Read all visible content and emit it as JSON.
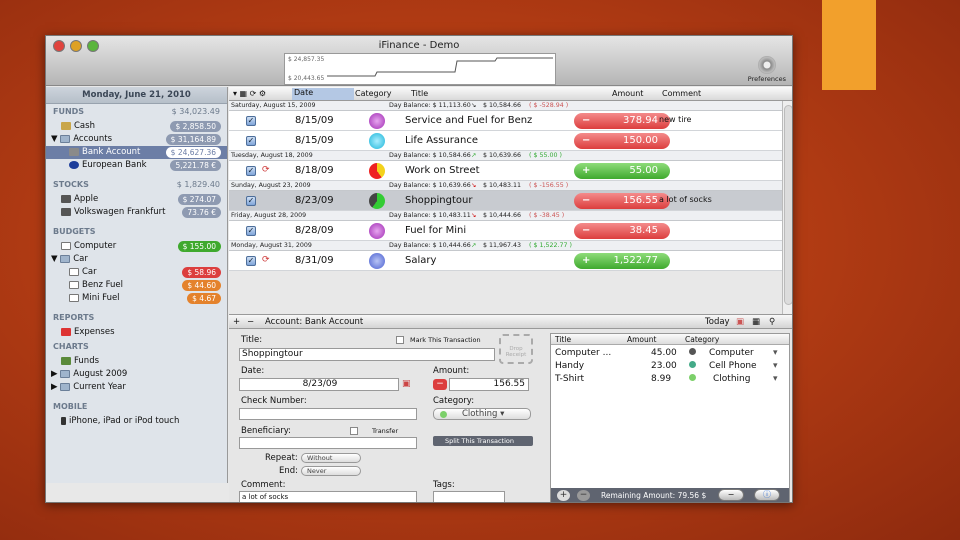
{
  "window": {
    "title": "iFinance - Demo"
  },
  "chart_header": {
    "label_top": "$ 24,857.35",
    "label_bottom": "$ 20,443.65"
  },
  "toolbar": {
    "preferences": "Preferences"
  },
  "sidebar": {
    "date": "Monday, June 21, 2010",
    "funds": {
      "label": "FUNDS",
      "amount": "$ 34,023.49",
      "items": [
        {
          "label": "Cash",
          "badge": "$ 2,858.50"
        },
        {
          "label": "Accounts",
          "badge": "$ 31,164.89"
        },
        {
          "label": "Bank Account",
          "badge": "$ 24,627.36"
        },
        {
          "label": "European Bank",
          "badge": "5,221.78 €"
        }
      ]
    },
    "stocks": {
      "label": "STOCKS",
      "amount": "$ 1,829.40",
      "items": [
        {
          "label": "Apple",
          "badge": "$ 274.07"
        },
        {
          "label": "Volkswagen Frankfurt",
          "badge": "73.76 €"
        }
      ]
    },
    "budgets": {
      "label": "BUDGETS",
      "items": [
        {
          "label": "Computer",
          "badge": "$ 155.00"
        },
        {
          "label": "Car"
        },
        {
          "label": "Car",
          "badge": "$ 58.96"
        },
        {
          "label": "Benz Fuel",
          "badge": "$ 44.60"
        },
        {
          "label": "Mini Fuel",
          "badge": "$ 4.67"
        }
      ]
    },
    "reports": {
      "label": "REPORTS",
      "items": [
        {
          "label": "Expenses"
        }
      ]
    },
    "charts": {
      "label": "CHARTS",
      "items": [
        {
          "label": "Funds"
        },
        {
          "label": "August 2009"
        },
        {
          "label": "Current Year"
        }
      ]
    },
    "mobile": {
      "label": "MOBILE",
      "items": [
        {
          "label": "iPhone, iPad or iPod touch"
        }
      ]
    }
  },
  "table": {
    "columns": [
      "Date",
      "Category",
      "Title",
      "Amount",
      "Comment"
    ],
    "days": [
      {
        "day": "Saturday, August 15, 2009",
        "balance": "Day Balance: $ 11,113.60",
        "after": "$ 10,584.66",
        "delta": "( $ -528.94 )"
      },
      {
        "day": "Tuesday, August 18, 2009",
        "balance": "Day Balance: $ 10,584.66",
        "after": "$ 10,639.66",
        "delta": "( $ 55.00 )"
      },
      {
        "day": "Sunday, August 23, 2009",
        "balance": "Day Balance: $ 10,639.66",
        "after": "$ 10,483.11",
        "delta": "( $ -156.55 )"
      },
      {
        "day": "Friday, August 28, 2009",
        "balance": "Day Balance: $ 10,483.11",
        "after": "$ 10,444.66",
        "delta": "( $ -38.45 )"
      },
      {
        "day": "Monday, August 31, 2009",
        "balance": "Day Balance: $ 10,444.66",
        "after": "$ 11,967.43",
        "delta": "( $ 1,522.77 )"
      }
    ],
    "rows": [
      {
        "date": "8/15/09",
        "title": "Service and Fuel for Benz",
        "amount": "378.94",
        "sign": "−",
        "comment": "new tire"
      },
      {
        "date": "8/15/09",
        "title": "Life Assurance",
        "amount": "150.00",
        "sign": "−",
        "comment": ""
      },
      {
        "date": "8/18/09",
        "title": "Work on Street",
        "amount": "55.00",
        "sign": "+",
        "comment": ""
      },
      {
        "date": "8/23/09",
        "title": "Shoppingtour",
        "amount": "156.55",
        "sign": "−",
        "comment": "a lot of socks"
      },
      {
        "date": "8/28/09",
        "title": "Fuel for Mini",
        "amount": "38.45",
        "sign": "−",
        "comment": ""
      },
      {
        "date": "8/31/09",
        "title": "Salary",
        "amount": "1,522.77",
        "sign": "+",
        "comment": ""
      }
    ],
    "footer": {
      "account": "Account: Bank Account",
      "today": "Today"
    }
  },
  "form": {
    "title_label": "Title:",
    "title_value": "Shoppingtour",
    "mark_label": "Mark This Transaction",
    "drop_label": "Drop Receipt",
    "date_label": "Date:",
    "date_value": "8/23/09",
    "amount_label": "Amount:",
    "amount_value": "156.55",
    "check_label": "Check Number:",
    "category_label": "Category:",
    "category_value": "Clothing",
    "beneficiary_label": "Beneficiary:",
    "transfer_label": "Transfer",
    "split_label": "Split This Transaction",
    "repeat_label": "Repeat:",
    "repeat_value": "Without",
    "end_label": "End:",
    "end_value": "Never",
    "comment_label": "Comment:",
    "comment_value": "a lot of socks",
    "tags_label": "Tags:"
  },
  "split": {
    "columns": [
      "Title",
      "Amount",
      "Category"
    ],
    "rows": [
      {
        "title": "Computer ...",
        "amount": "45.00",
        "category": "Computer"
      },
      {
        "title": "Handy",
        "amount": "23.00",
        "category": "Cell Phone"
      },
      {
        "title": "T-Shirt",
        "amount": "8.99",
        "category": "Clothing"
      }
    ],
    "remaining": "Remaining Amount: 79.56 $"
  },
  "colors": {
    "negative": "#dc3e3e",
    "positive": "#3fa92e",
    "selection": "#6c7ea6"
  }
}
